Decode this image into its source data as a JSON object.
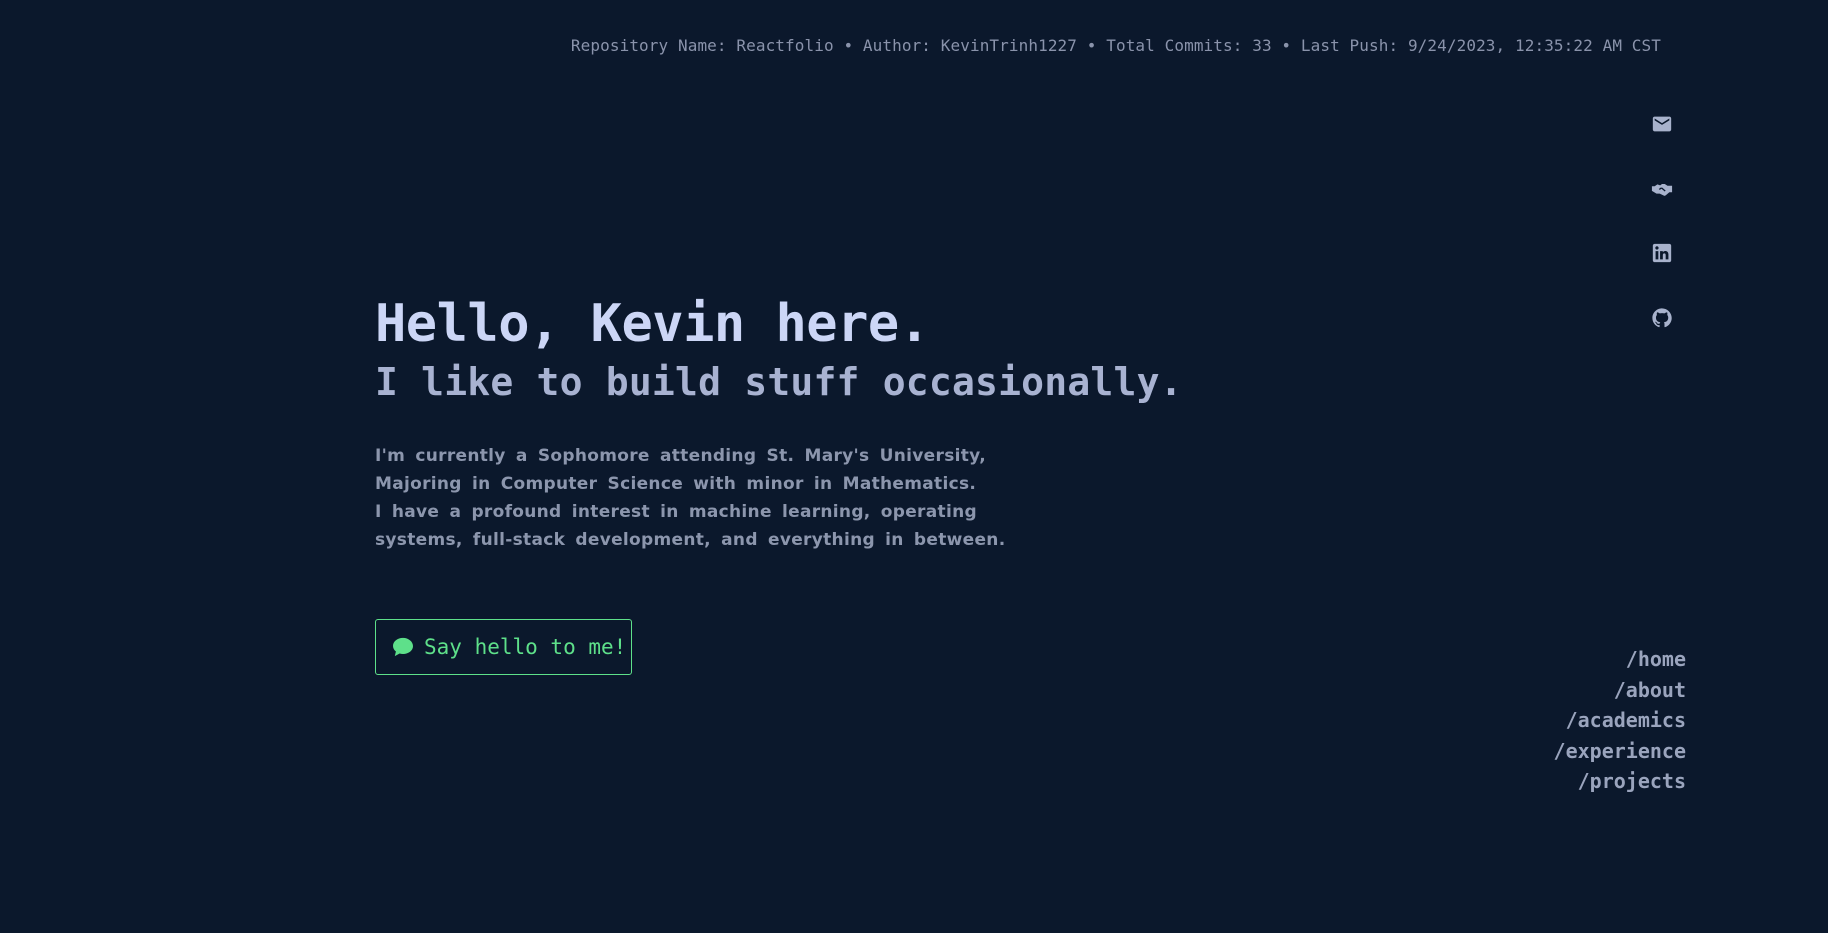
{
  "header": {
    "repo_info": "Repository Name: Reactfolio • Author: KevinTrinh1227 • Total Commits: 33 • Last Push: 9/24/2023, 12:35:22 AM CST"
  },
  "socials": [
    {
      "icon": "mail-icon"
    },
    {
      "icon": "handshake-icon"
    },
    {
      "icon": "linkedin-icon"
    },
    {
      "icon": "github-icon"
    }
  ],
  "hero": {
    "title": "Hello, Kevin here.",
    "subtitle": "I like to build stuff occasionally.",
    "description": [
      "I'm currently a Sophomore attending St. Mary's University,",
      "Majoring in Computer Science with minor in Mathematics.",
      "I have a profound interest in machine learning, operating",
      "systems, full-stack development, and everything in between."
    ],
    "button_label": "Say hello to me!",
    "button_icon": "chat-bubble-icon"
  },
  "nav": {
    "items": [
      "/home",
      "/about",
      "/academics",
      "/experience",
      "/projects"
    ]
  },
  "colors": {
    "background": "#0b182c",
    "accent": "#5ee08a",
    "title": "#ccd6f6",
    "text": "#8c96ad"
  }
}
